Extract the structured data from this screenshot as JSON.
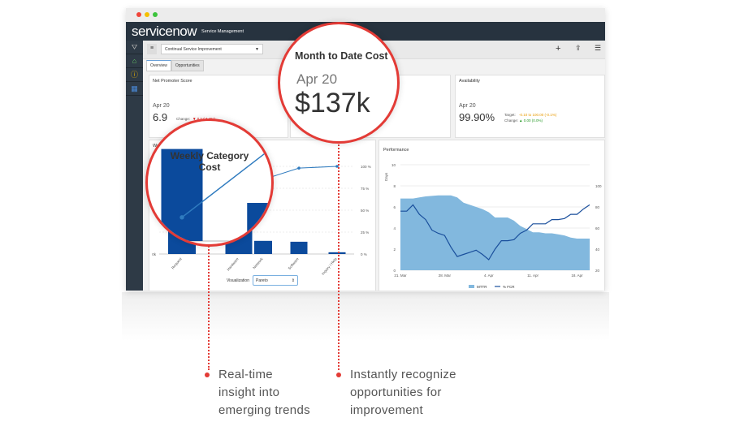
{
  "header": {
    "logo": "servicenow",
    "app": "Service Management"
  },
  "sidebar": {
    "items": [
      {
        "icon": "filter-icon"
      },
      {
        "icon": "home-icon"
      },
      {
        "icon": "alert-icon"
      },
      {
        "icon": "report-icon"
      }
    ]
  },
  "toolbar": {
    "dashboard": "Continual Service Improvement",
    "add": "+",
    "share": "⇪",
    "settings": "☰"
  },
  "tabs": [
    {
      "label": "Overview",
      "active": true
    },
    {
      "label": "Opportunities",
      "active": false
    }
  ],
  "nps": {
    "title": "Net Promoter Score",
    "date": "Apr 20",
    "value": "6.9",
    "change_label": "Change:",
    "change": "▼ 0.1 (-1.4%)"
  },
  "cost": {
    "title": "Month to Date Cost",
    "date": "Apr 20",
    "value": "$137k"
  },
  "availability": {
    "title": "Availability",
    "date": "Apr 20",
    "value": "99.90%",
    "target_label": "Target:",
    "target": "-0.10 to 100.00 (-0.1%)",
    "change_label": "Change:",
    "change": "▲ 0.00 (0.0%)"
  },
  "weekly": {
    "title_short": "Weekly",
    "title": "Weekly Category Cost",
    "viz_label": "Visualization",
    "viz_value": "Pareto"
  },
  "colors": {
    "accent_red": "#e33b36",
    "bar": "#0b4a9c",
    "area": "#82b8de",
    "line": "#1a4f9c"
  },
  "chart_data": [
    {
      "type": "bar",
      "title": "Weekly Category Cost",
      "categories": [
        "Request",
        "Hardware",
        "Network",
        "Software",
        "Inquiry / Help"
      ],
      "values": [
        70,
        29,
        15,
        14,
        2
      ],
      "cumulative_percent": [
        18,
        68,
        85,
        98,
        100
      ],
      "left_ticks": [
        "0k"
      ],
      "right_ticks": [
        "0 %",
        "25 %",
        "50 %",
        "75 %",
        "100 %"
      ]
    },
    {
      "type": "area",
      "title": "Performance",
      "ylabel": "Days",
      "ylim": [
        0,
        10
      ],
      "y2lim": [
        20,
        100
      ],
      "left_ticks": [
        "0",
        "2",
        "4",
        "6",
        "8",
        "10"
      ],
      "right_ticks": [
        "20",
        "40",
        "60",
        "80",
        "100"
      ],
      "x_ticks": [
        "21. Mar",
        "28. Mar",
        "4. Apr",
        "11. Apr",
        "18. Apr"
      ],
      "series": [
        {
          "name": "MTTR",
          "values": [
            6.8,
            6.8,
            6.8,
            6.9,
            7.0,
            7.05,
            7.1,
            7.1,
            7.1,
            6.9,
            6.4,
            6.2,
            6.0,
            5.8,
            5.5,
            5.0,
            5.0,
            5.0,
            4.7,
            4.2,
            3.9,
            3.6,
            3.6,
            3.5,
            3.5,
            3.4,
            3.3,
            3.1,
            3.0,
            3.0,
            3.0
          ]
        },
        {
          "name": "% FCR",
          "values": [
            76,
            76,
            82,
            73,
            68,
            58,
            55,
            53,
            42,
            33,
            35,
            37,
            39,
            35,
            30,
            40,
            48,
            48,
            49,
            55,
            58,
            64,
            64,
            64,
            68,
            68,
            69,
            73,
            73,
            78,
            82
          ]
        }
      ]
    }
  ],
  "captions": {
    "left": [
      "Real-time",
      "insight into",
      "emerging trends"
    ],
    "right": [
      "Instantly recognize",
      "opportunities for",
      "improvement"
    ]
  }
}
